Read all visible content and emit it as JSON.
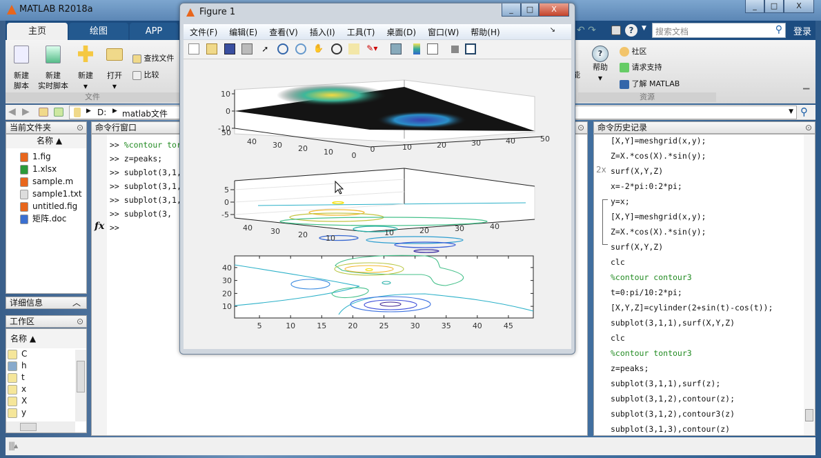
{
  "app": {
    "title": "MATLAB R2018a",
    "win_controls": [
      "_",
      "□",
      "X"
    ]
  },
  "tabs": [
    {
      "label": "主页"
    },
    {
      "label": "绘图"
    },
    {
      "label": "APP"
    }
  ],
  "ribbon": {
    "buttons": [
      {
        "label": "新建\n脚本"
      },
      {
        "label": "新建\n实时脚本"
      },
      {
        "label": "新建"
      },
      {
        "label": "打开"
      }
    ],
    "small": [
      {
        "label": "查找文件"
      },
      {
        "label": "比较"
      }
    ],
    "group_file": "文件",
    "help_label": "帮助",
    "cut_label": "能",
    "resources": [
      {
        "label": "社区"
      },
      {
        "label": "请求支持"
      },
      {
        "label": "了解 MATLAB"
      }
    ],
    "group_resources": "资源",
    "search_placeholder": "搜索文档",
    "login": "登录"
  },
  "address": {
    "drive": "D:",
    "folder": "matlab文件"
  },
  "current_folder": {
    "title": "当前文件夹",
    "col_name": "名称 ▲",
    "files": [
      {
        "name": "1.fig",
        "type": "fig"
      },
      {
        "name": "1.xlsx",
        "type": "xlsx"
      },
      {
        "name": "sample.m",
        "type": "m"
      },
      {
        "name": "sample1.txt",
        "type": "txt"
      },
      {
        "name": "untitled.fig",
        "type": "fig"
      },
      {
        "name": "矩阵.doc",
        "type": "doc"
      }
    ]
  },
  "details": {
    "title": "详细信息"
  },
  "workspace": {
    "title": "工作区",
    "col_name": "名称 ▲",
    "vars": [
      "C",
      "h",
      "t",
      "x",
      "X",
      "y"
    ]
  },
  "command": {
    "title": "命令行窗口",
    "prompt": ">>",
    "fx": "fx",
    "lines": [
      {
        "text": "%contour tor",
        "comment": true
      },
      {
        "text": "z=peaks;"
      },
      {
        "text": "subplot(3,1,"
      },
      {
        "text": "subplot(3,1,"
      },
      {
        "text": "subplot(3,1,"
      },
      {
        "text": " subplot(3,"
      },
      {
        "text": ""
      }
    ]
  },
  "history": {
    "title": "命令历史记录",
    "badge": "2x",
    "lines": [
      {
        "text": "[X,Y]=meshgrid(x,y);"
      },
      {
        "text": "Z=X.*cos(X).*sin(y);"
      },
      {
        "text": "surf(X,Y,Z)"
      },
      {
        "text": "x=-2*pi:0:2*pi;"
      },
      {
        "text": "y=x;"
      },
      {
        "text": "[X,Y]=meshgrid(x,y);"
      },
      {
        "text": "Z=X.*cos(X).*sin(y);"
      },
      {
        "text": "surf(X,Y,Z)"
      },
      {
        "text": "clc"
      },
      {
        "text": "%contour contour3",
        "comment": true
      },
      {
        "text": "t=0:pi/10:2*pi;"
      },
      {
        "text": "[X,Y,Z]=cylinder(2+sin(t)-cos(t));"
      },
      {
        "text": "subplot(3,1,1),surf(X,Y,Z)"
      },
      {
        "text": "clc"
      },
      {
        "text": "%contour tontour3",
        "comment": true
      },
      {
        "text": "z=peaks;"
      },
      {
        "text": "subplot(3,1,1),surf(z);"
      },
      {
        "text": "subplot(3,1,2),contour(z);"
      },
      {
        "text": "subplot(3,1,2),contour3(z)"
      },
      {
        "text": "subplot(3,1,3),contour(z)"
      }
    ]
  },
  "figure": {
    "title": "Figure 1",
    "menu": [
      "文件(F)",
      "编辑(E)",
      "查看(V)",
      "插入(I)",
      "工具(T)",
      "桌面(D)",
      "窗口(W)",
      "帮助(H)"
    ]
  },
  "chart_data": [
    {
      "type": "surface",
      "title": "",
      "zticks": [
        "10",
        "0",
        "-10"
      ],
      "yticks": [
        "50",
        "40",
        "30",
        "20",
        "10",
        "0"
      ],
      "xticks": [
        "0",
        "10",
        "20",
        "30",
        "40",
        "50"
      ],
      "zlim": [
        -10,
        10
      ],
      "xlim": [
        0,
        50
      ],
      "ylim": [
        0,
        50
      ]
    },
    {
      "type": "contour3",
      "zticks": [
        "5",
        "0",
        "-5"
      ],
      "yticks": [
        "40",
        "30",
        "20",
        "10"
      ],
      "xticks": [
        "10",
        "20",
        "30",
        "40"
      ]
    },
    {
      "type": "contour",
      "xticks": [
        5,
        10,
        15,
        20,
        25,
        30,
        35,
        40,
        45
      ],
      "yticks": [
        10,
        20,
        30,
        40
      ],
      "xlim": [
        1,
        49
      ],
      "ylim": [
        1,
        49
      ]
    }
  ]
}
